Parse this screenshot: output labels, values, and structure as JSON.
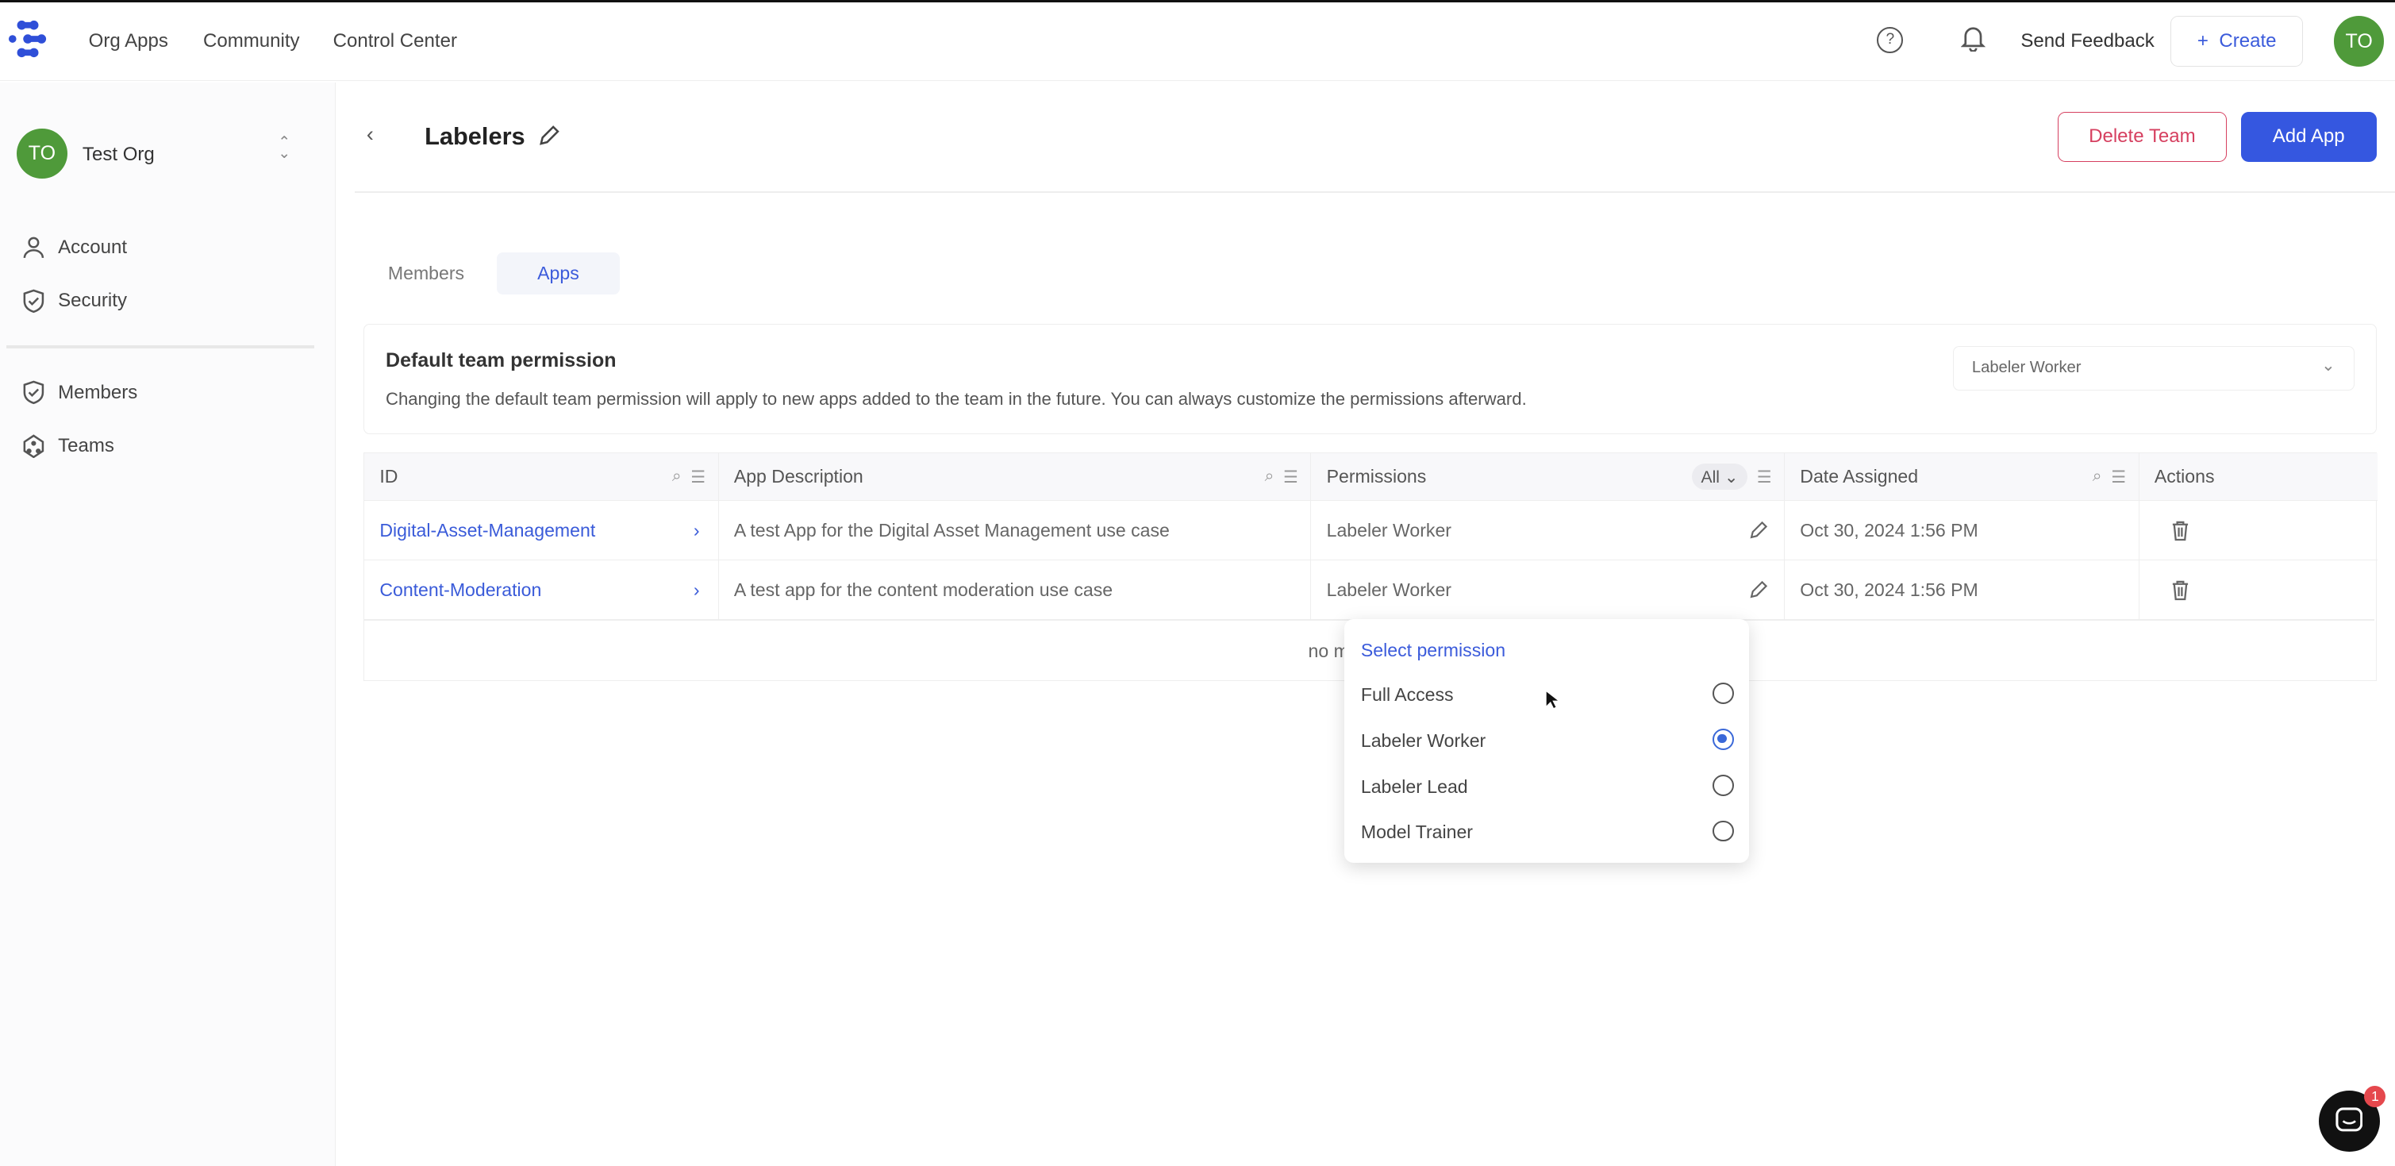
{
  "topnav": {
    "items": [
      "Org Apps",
      "Community",
      "Control Center"
    ],
    "send_feedback": "Send Feedback",
    "create": "Create",
    "avatar": "TO"
  },
  "sidebar": {
    "org": {
      "avatar": "TO",
      "name": "Test Org"
    },
    "items": [
      {
        "label": "Account",
        "icon": "user-icon"
      },
      {
        "label": "Security",
        "icon": "shield-icon"
      },
      {
        "label": "Members",
        "icon": "shield-check-icon"
      },
      {
        "label": "Teams",
        "icon": "teams-icon"
      }
    ]
  },
  "header": {
    "title": "Labelers",
    "delete_team": "Delete Team",
    "add_app": "Add App"
  },
  "tabs": [
    {
      "label": "Members",
      "active": false
    },
    {
      "label": "Apps",
      "active": true
    }
  ],
  "default_permission": {
    "title": "Default team permission",
    "description": "Changing the default team permission will apply to new apps added to the team in the future. You can always customize the permissions afterward.",
    "selected": "Labeler Worker"
  },
  "table": {
    "columns": [
      "ID",
      "App Description",
      "Permissions",
      "Date Assigned",
      "Actions"
    ],
    "permissions_filter": "All",
    "rows": [
      {
        "id": "Digital-Asset-Management",
        "description": "A test App for the Digital Asset Management use case",
        "permission": "Labeler Worker",
        "date": "Oct 30, 2024 1:56 PM"
      },
      {
        "id": "Content-Moderation",
        "description": "A test app for the content moderation use case",
        "permission": "Labeler Worker",
        "date": "Oct 30, 2024 1:56 PM"
      }
    ],
    "footer_partial": "no m"
  },
  "permission_menu": {
    "title": "Select permission",
    "options": [
      {
        "label": "Full Access",
        "selected": false
      },
      {
        "label": "Labeler Worker",
        "selected": true
      },
      {
        "label": "Labeler Lead",
        "selected": false
      },
      {
        "label": "Model Trainer",
        "selected": false
      }
    ]
  },
  "chat": {
    "badge": "1"
  },
  "colors": {
    "accent": "#3b5bdb",
    "danger": "#d64060",
    "avatar": "#4f9a3a"
  }
}
